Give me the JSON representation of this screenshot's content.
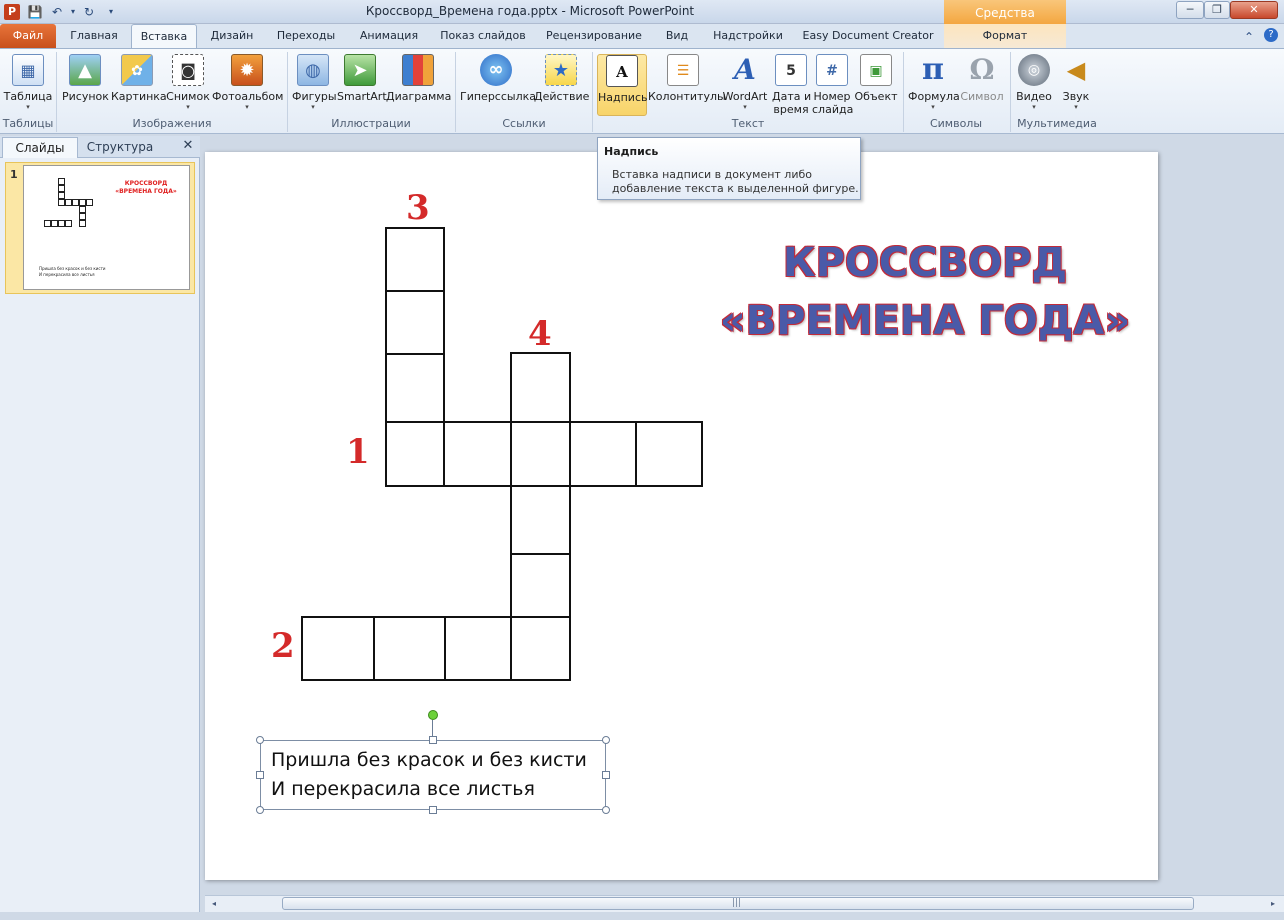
{
  "window": {
    "title": "Кроссворд_Времена года.pptx - Microsoft PowerPoint",
    "contextual_group": "Средства рисования",
    "app_icon_letter": "P",
    "minimize_glyph": "─",
    "restore_glyph": "❐",
    "close_glyph": "✕"
  },
  "quick_access": {
    "save_glyph": "💾",
    "undo_glyph": "↶",
    "redo_glyph": "↻",
    "more_glyph": "▾"
  },
  "tabs": {
    "file": "Файл",
    "home": "Главная",
    "insert": "Вставка",
    "design": "Дизайн",
    "transitions": "Переходы",
    "animations": "Анимация",
    "slideshow": "Показ слайдов",
    "review": "Рецензирование",
    "view": "Вид",
    "addins": "Надстройки",
    "easydoc": "Easy Document Creator",
    "format": "Формат",
    "minimize_ribbon_glyph": "⌃",
    "help_glyph": "?"
  },
  "ribbon": {
    "groups": {
      "tables": "Таблицы",
      "images": "Изображения",
      "illustrations": "Иллюстрации",
      "links": "Ссылки",
      "text": "Текст",
      "symbols": "Символы",
      "media": "Мультимедиа"
    },
    "buttons": {
      "table": "Таблица",
      "picture": "Рисунок",
      "clipart": "Картинка",
      "screenshot": "Снимок",
      "photoalbum": "Фотоальбом",
      "shapes": "Фигуры",
      "smartart": "SmartArt",
      "chart": "Диаграмма",
      "hyperlink": "Гиперссылка",
      "action": "Действие",
      "textbox": "Надпись",
      "headerfooter": "Колонтитулы",
      "wordart": "WordArt",
      "datetime_1": "Дата и",
      "datetime_2": "время",
      "slidenum_1": "Номер",
      "slidenum_2": "слайда",
      "object": "Объект",
      "equation": "Формула",
      "symbol": "Символ",
      "video": "Видео",
      "audio": "Звук"
    },
    "arrow_glyph": "▾"
  },
  "tooltip": {
    "title": "Надпись",
    "line1": "Вставка надписи в документ либо",
    "line2": "добавление текста к выделенной фигуре."
  },
  "slides_panel": {
    "tab_slides": "Слайды",
    "tab_outline": "Структура",
    "close_glyph": "✕",
    "thumb_number": "1",
    "thumb_title_1": "КРОССВОРД",
    "thumb_title_2": "«ВРЕМЕНА ГОДА»",
    "thumb_text_1": "Пришла без красок и без кисти",
    "thumb_text_2": "И перекрасила все листья"
  },
  "slide": {
    "title_line1": "КРОССВОРД",
    "title_line2": "«ВРЕМЕНА ГОДА»",
    "clue_numbers": {
      "n1": "1",
      "n2": "2",
      "n3": "3",
      "n4": "4"
    },
    "textbox_line1": "Пришла без красок и без кисти",
    "textbox_line2": "И перекрасила все листья",
    "title_fill_color": "#4a5aa8",
    "title_outline_color": "#c22b3a",
    "number_color": "#d42a2a"
  },
  "scrollbar": {
    "left_glyph": "◂",
    "right_glyph": "▸",
    "grip_glyph": "|||"
  }
}
